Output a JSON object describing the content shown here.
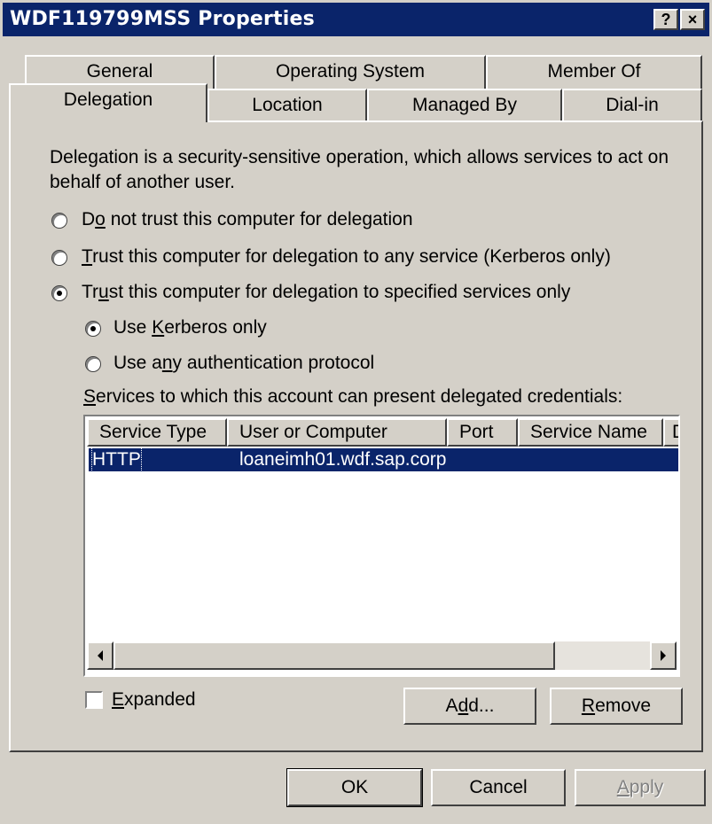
{
  "window": {
    "title": "WDF119799MSS Properties",
    "help_label": "?",
    "close_label": "×"
  },
  "tabs": {
    "row1": [
      "General",
      "Operating System",
      "Member Of"
    ],
    "row2": [
      "Delegation",
      "Location",
      "Managed By",
      "Dial-in"
    ],
    "active": "Delegation"
  },
  "panel": {
    "description": "Delegation is a security-sensitive operation, which allows services to act on behalf of another user.",
    "radio_options": [
      {
        "pre": "D",
        "key": "o",
        "post": " not trust this computer for delegation",
        "selected": false
      },
      {
        "pre": "",
        "key": "T",
        "post": "rust this computer for delegation to any service (Kerberos only)",
        "selected": false
      },
      {
        "pre": "Tr",
        "key": "u",
        "post": "st this computer for delegation to specified services only",
        "selected": true
      }
    ],
    "sub_options": [
      {
        "pre": "Use ",
        "key": "K",
        "post": "erberos only",
        "selected": true
      },
      {
        "pre": "Use a",
        "key": "n",
        "post": "y authentication protocol",
        "selected": false
      }
    ],
    "services_label_key": "S",
    "services_label_rest": "ervices to which this account can present delegated credentials:",
    "columns": [
      "Service Type",
      "User or Computer",
      "Port",
      "Service Name",
      "D"
    ],
    "rows": [
      {
        "service_type": "HTTP",
        "user_or_computer": "loaneimh01.wdf.sap.corp",
        "port": "",
        "service_name": "",
        "selected": true
      }
    ],
    "expanded_checkbox": {
      "key": "E",
      "rest": "xpanded",
      "checked": false
    },
    "add_button": {
      "pre": "A",
      "key": "d",
      "post": "d..."
    },
    "remove_button": {
      "pre": "",
      "key": "R",
      "post": "emove"
    }
  },
  "buttons": {
    "ok": "OK",
    "cancel": "Cancel",
    "apply_key": "A",
    "apply_rest": "pply"
  },
  "colors": {
    "titlebar": "#0a246a",
    "face": "#d4d0c8",
    "selection": "#0a246a"
  }
}
